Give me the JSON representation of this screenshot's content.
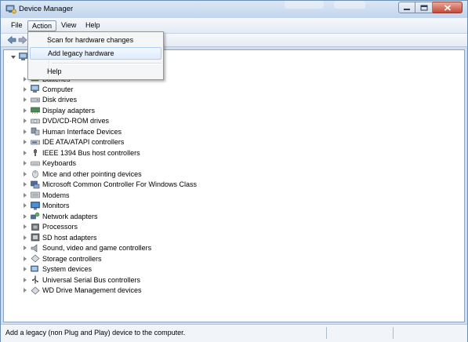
{
  "window": {
    "title": "Device Manager"
  },
  "menu": {
    "file": "File",
    "action": "Action",
    "view": "View",
    "help": "Help"
  },
  "action_menu": {
    "items": [
      "Scan for hardware changes",
      "Add legacy hardware",
      "Help"
    ]
  },
  "tree": {
    "root_partial": "...",
    "partial_item": "Batteries",
    "items": [
      "Computer",
      "Disk drives",
      "Display adapters",
      "DVD/CD-ROM drives",
      "Human Interface Devices",
      "IDE ATA/ATAPI controllers",
      "IEEE 1394 Bus host controllers",
      "Keyboards",
      "Mice and other pointing devices",
      "Microsoft Common Controller For Windows Class",
      "Modems",
      "Monitors",
      "Network adapters",
      "Processors",
      "SD host adapters",
      "Sound, video and game controllers",
      "Storage controllers",
      "System devices",
      "Universal Serial Bus controllers",
      "WD Drive Management devices"
    ]
  },
  "status": {
    "text": "Add a legacy (non Plug and Play) device to the computer."
  }
}
